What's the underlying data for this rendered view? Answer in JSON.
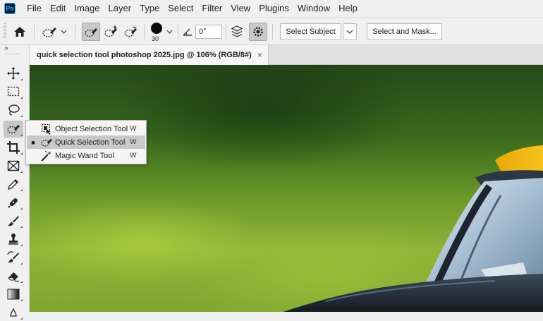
{
  "app": {
    "logo_text": "Ps"
  },
  "menu": [
    "File",
    "Edit",
    "Image",
    "Layer",
    "Type",
    "Select",
    "Filter",
    "View",
    "Plugins",
    "Window",
    "Help"
  ],
  "options_bar": {
    "brush_size": "30",
    "angle_value": "0°",
    "select_subject_label": "Select Subject",
    "select_and_mask_label": "Select and Mask..."
  },
  "toolbar": {
    "collapse_glyph": "››"
  },
  "document_tab": {
    "title": "quick selection tool photoshop 2025.jpg @ 106% (RGB/8#)",
    "close_glyph": "×"
  },
  "flyout": {
    "items": [
      {
        "label": "Object Selection Tool",
        "shortcut": "W",
        "selected": false
      },
      {
        "label": "Quick Selection Tool",
        "shortcut": "W",
        "selected": true
      },
      {
        "label": "Magic Wand Tool",
        "shortcut": "W",
        "selected": false
      }
    ],
    "selected_marker": "■"
  },
  "colors": {
    "accent": "#31a8ff",
    "canvas_green": "#6d9b2a",
    "car_yellow": "#f0b60c"
  }
}
